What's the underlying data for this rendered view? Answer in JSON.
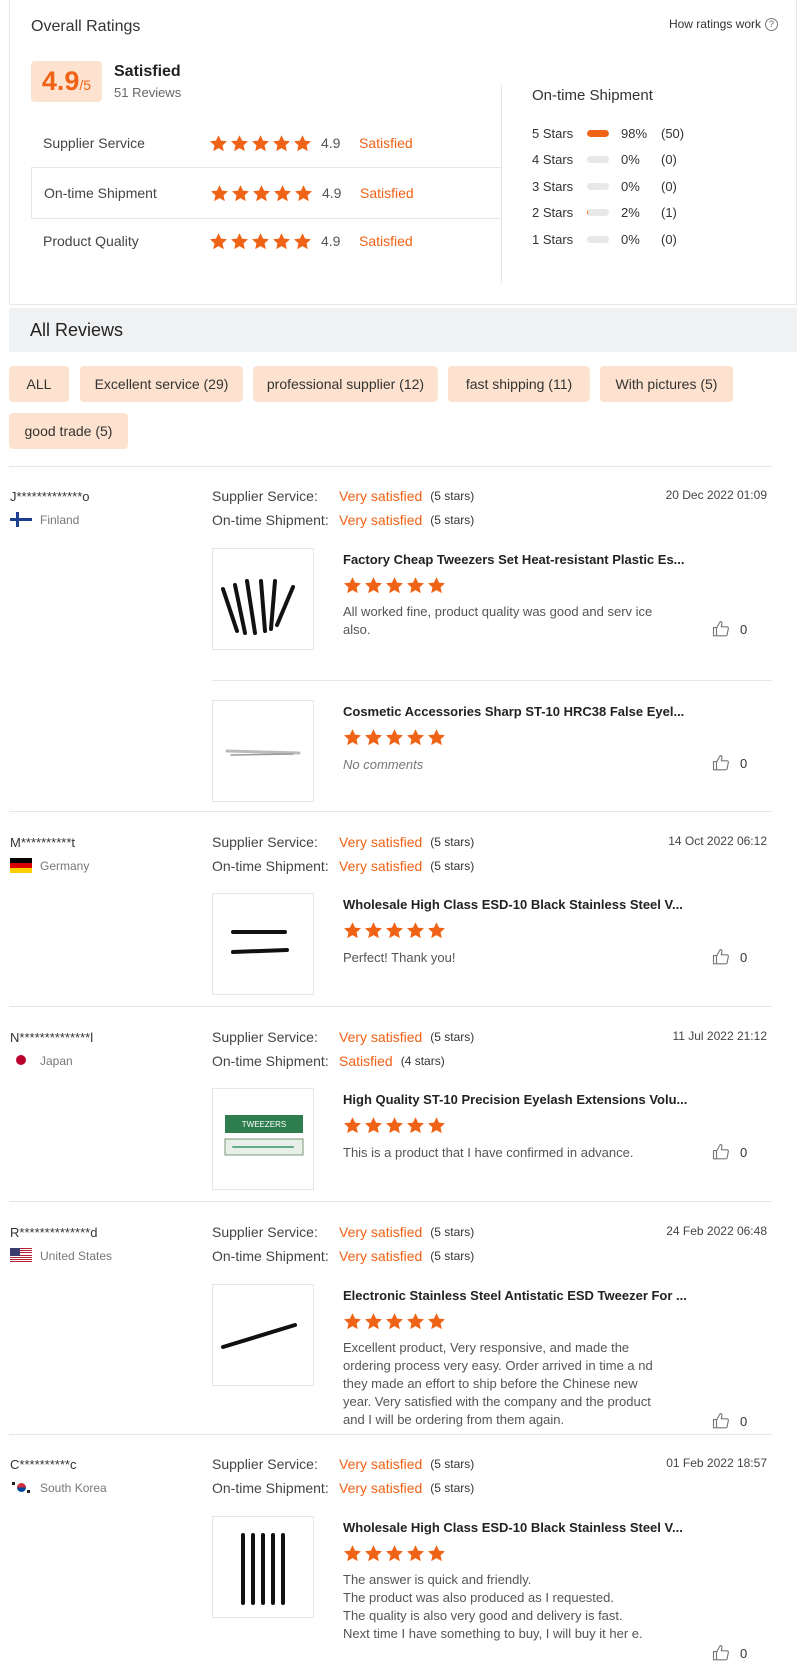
{
  "overall": {
    "title": "Overall Ratings",
    "how_link": "How ratings work",
    "score": "4.9",
    "score_den": "/5",
    "score_label": "Satisfied",
    "review_count": "51 Reviews",
    "rows": [
      {
        "label": "Supplier Service",
        "stars": 5,
        "value": "4.9",
        "text": "Satisfied"
      },
      {
        "label": "On-time Shipment",
        "stars": 5,
        "value": "4.9",
        "text": "Satisfied"
      },
      {
        "label": "Product Quality",
        "stars": 5,
        "value": "4.9",
        "text": "Satisfied"
      }
    ]
  },
  "shipment": {
    "title": "On-time Shipment",
    "rows": [
      {
        "label": "5 Stars",
        "fraction": 0.98,
        "pct": "98%",
        "count": "(50)"
      },
      {
        "label": "4 Stars",
        "fraction": 0,
        "pct": "0%",
        "count": "(0)"
      },
      {
        "label": "3 Stars",
        "fraction": 0,
        "pct": "0%",
        "count": "(0)"
      },
      {
        "label": "2 Stars",
        "fraction": 0.02,
        "pct": "2%",
        "count": "(1)"
      },
      {
        "label": "1 Stars",
        "fraction": 0,
        "pct": "0%",
        "count": "(0)"
      }
    ]
  },
  "reviews_header": "All Reviews",
  "tags": [
    "ALL",
    "Excellent service (29)",
    "professional supplier (12)",
    "fast shipping (11)",
    "With pictures (5)",
    "good trade (5)"
  ],
  "accent_color": "#f06215",
  "reviews": [
    {
      "user": "J*************o",
      "country": "Finland",
      "flag": "finland",
      "date": "20 Dec 2022 01:09",
      "supplier_label": "Supplier Service:",
      "supplier_value": "Very satisfied",
      "supplier_stars": "(5 stars)",
      "shipment_label": "On-time Shipment:",
      "shipment_value": "Very satisfied",
      "shipment_stars": "(5 stars)",
      "products": [
        {
          "title": "Factory Cheap Tweezers Set Heat-resistant Plastic Es...",
          "stars": 5,
          "comment": "All worked fine, product quality was good and serv ice also.",
          "likes": "0",
          "img": "tweezers-set"
        },
        {
          "title": "Cosmetic Accessories Sharp ST-10 HRC38 False Eyel...",
          "stars": 5,
          "comment": "No comments",
          "likes": "0",
          "img": "single-silver"
        }
      ]
    },
    {
      "user": "M**********t",
      "country": "Germany",
      "flag": "germany",
      "date": "14 Oct 2022 06:12",
      "supplier_label": "Supplier Service:",
      "supplier_value": "Very satisfied",
      "supplier_stars": "(5 stars)",
      "shipment_label": "On-time Shipment:",
      "shipment_value": "Very satisfied",
      "shipment_stars": "(5 stars)",
      "products": [
        {
          "title": "Wholesale High Class ESD-10 Black Stainless Steel V...",
          "stars": 5,
          "comment": "Perfect! Thank you!",
          "likes": "0",
          "img": "two-black"
        }
      ]
    },
    {
      "user": "N**************l",
      "country": "Japan",
      "flag": "japan",
      "date": "11 Jul 2022 21:12",
      "supplier_label": "Supplier Service:",
      "supplier_value": "Very satisfied",
      "supplier_stars": "(5 stars)",
      "shipment_label": "On-time Shipment:",
      "shipment_value": "Satisfied",
      "shipment_stars": "(4 stars)",
      "products": [
        {
          "title": "High Quality ST-10 Precision Eyelash Extensions Volu...",
          "stars": 5,
          "comment": "This is a product that I have confirmed in advance.",
          "likes": "0",
          "img": "packs",
          "pack_label": "TWEEZERS"
        }
      ]
    },
    {
      "user": "R**************d",
      "country": "United States",
      "flag": "usa",
      "date": "24 Feb 2022 06:48",
      "supplier_label": "Supplier Service:",
      "supplier_value": "Very satisfied",
      "supplier_stars": "(5 stars)",
      "shipment_label": "On-time Shipment:",
      "shipment_value": "Very satisfied",
      "shipment_stars": "(5 stars)",
      "products": [
        {
          "title": "Electronic Stainless Steel Antistatic ESD Tweezer For ...",
          "stars": 5,
          "comment": "Excellent product, Very responsive, and made the ordering process very easy. Order arrived in time a nd they made an effort to ship before the Chinese new year. Very satisfied with the company and the product and I will be ordering from them again.",
          "likes": "0",
          "img": "one-black"
        }
      ]
    },
    {
      "user": "C**********c",
      "country": "South Korea",
      "flag": "korea",
      "date": "01 Feb 2022 18:57",
      "supplier_label": "Supplier Service:",
      "supplier_value": "Very satisfied",
      "supplier_stars": "(5 stars)",
      "shipment_label": "On-time Shipment:",
      "shipment_value": "Very satisfied",
      "shipment_stars": "(5 stars)",
      "products": [
        {
          "title": "Wholesale High Class ESD-10 Black Stainless Steel V...",
          "stars": 5,
          "comment": "The answer is quick and friendly.\nThe product was also produced as I requested.\nThe quality is also very good and delivery is fast.\nNext time I have something to buy, I will buy it her e.",
          "likes": "0",
          "img": "five-black"
        }
      ]
    }
  ]
}
